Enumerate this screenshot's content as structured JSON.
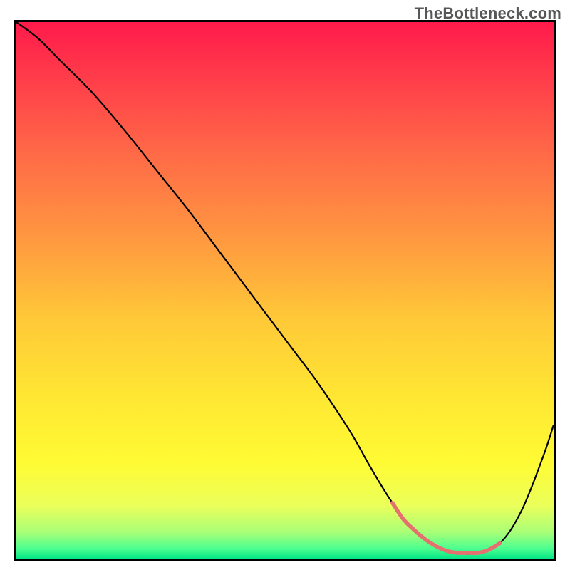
{
  "watermark": "TheBottleneck.com",
  "chart_data": {
    "type": "line",
    "title": "",
    "xlabel": "",
    "ylabel": "",
    "xlim": [
      0,
      100
    ],
    "ylim": [
      0,
      100
    ],
    "background_gradient": {
      "stops": [
        {
          "offset": 0.0,
          "color": "#ff1a4b"
        },
        {
          "offset": 0.1,
          "color": "#ff3b4a"
        },
        {
          "offset": 0.25,
          "color": "#ff6b47"
        },
        {
          "offset": 0.4,
          "color": "#ff9740"
        },
        {
          "offset": 0.55,
          "color": "#ffc838"
        },
        {
          "offset": 0.7,
          "color": "#ffe733"
        },
        {
          "offset": 0.82,
          "color": "#fffb33"
        },
        {
          "offset": 0.9,
          "color": "#eBff5a"
        },
        {
          "offset": 0.95,
          "color": "#a8ff78"
        },
        {
          "offset": 0.98,
          "color": "#4cff8f"
        },
        {
          "offset": 1.0,
          "color": "#00e487"
        }
      ]
    },
    "series": [
      {
        "name": "bottleneck-curve",
        "color": "#000000",
        "width": 2.2,
        "x": [
          0,
          4,
          8,
          14,
          20,
          26,
          32,
          38,
          44,
          50,
          56,
          62,
          66,
          70,
          74,
          78,
          82,
          86,
          90,
          94,
          98,
          100
        ],
        "values": [
          100,
          97,
          93,
          87,
          80,
          72.5,
          65,
          57,
          49,
          41,
          33,
          24,
          17,
          10.5,
          5.5,
          2.5,
          1.2,
          1.2,
          3.0,
          9,
          19,
          25
        ]
      },
      {
        "name": "optimal-range-marker",
        "color": "#e4716f",
        "width": 5.5,
        "x": [
          70,
          72,
          74,
          76,
          78,
          80,
          82,
          84,
          86,
          88,
          90
        ],
        "values": [
          10.5,
          7.5,
          5.5,
          3.8,
          2.5,
          1.6,
          1.2,
          1.2,
          1.2,
          1.8,
          3.0
        ]
      }
    ]
  }
}
